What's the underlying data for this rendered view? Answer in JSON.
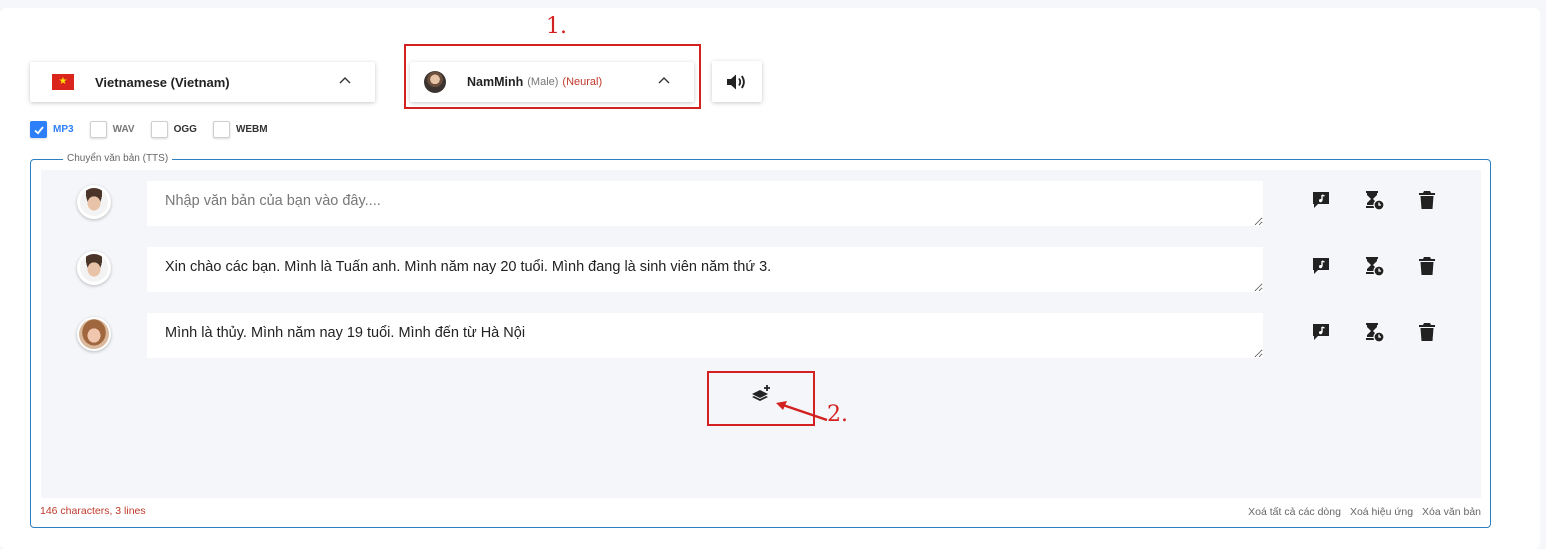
{
  "language": {
    "label": "Vietnamese (Vietnam)",
    "flag_icon": "vietnam-flag-icon"
  },
  "voice": {
    "name": "NamMinh",
    "gender": "(Male)",
    "type": "(Neural)"
  },
  "annotations": {
    "label1": "1.",
    "label2": "2."
  },
  "formats": [
    {
      "label": "MP3",
      "checked": true
    },
    {
      "label": "WAV",
      "checked": false
    },
    {
      "label": "OGG",
      "checked": false
    },
    {
      "label": "WEBM",
      "checked": false
    }
  ],
  "tts": {
    "legend": "Chuyển văn bản (TTS)",
    "placeholder": "Nhập văn bản của bạn vào đây....",
    "rows": [
      {
        "text": ""
      },
      {
        "text": "Xin chào các bạn. Mình là Tuấn anh. Mình năm nay 20 tuổi. Mình đang là sinh viên năm thứ 3."
      },
      {
        "text": "Mình là thủy. Mình năm nay 19 tuổi. Mình đến từ Hà Nội"
      }
    ]
  },
  "footer": {
    "stats": "146 characters, 3 lines",
    "clear_all_rows": "Xoá tất cả các dòng",
    "clear_effects": "Xoá hiệu ứng",
    "clear_text": "Xóa văn bản"
  },
  "colors": {
    "accent": "#2d7ff9",
    "annotation": "#d32020",
    "border": "#2d7fbf",
    "error_text": "#c0392b"
  }
}
